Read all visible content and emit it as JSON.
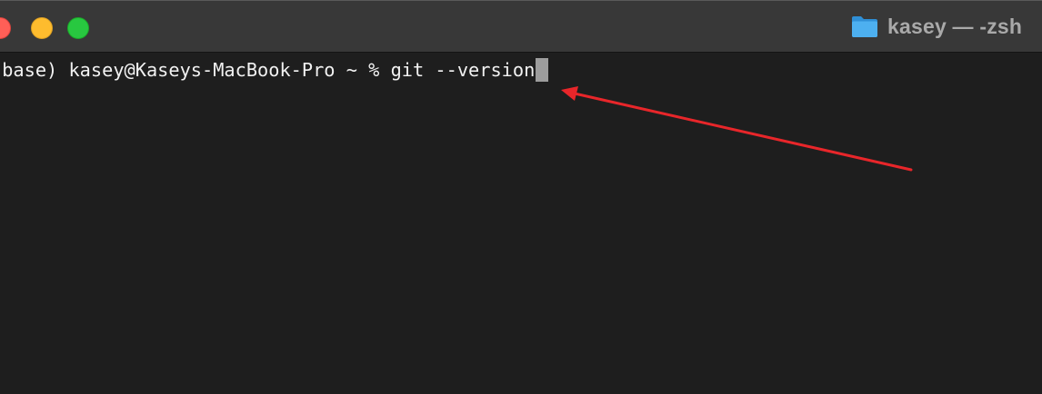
{
  "window": {
    "title": "kasey — -zsh",
    "title_icon": "folder-icon",
    "controls": [
      "close",
      "minimize",
      "zoom"
    ]
  },
  "terminal": {
    "prompt": "(base) kasey@Kaseys-MacBook-Pro ~ % ",
    "command": "git --version"
  },
  "annotation": {
    "type": "arrow",
    "color": "#e8262a"
  },
  "colors": {
    "background": "#1e1e1e",
    "titlebar": "#383838",
    "text": "#f2f2f2",
    "cursor": "#9d9d9d",
    "folder": "#3fa3e8"
  }
}
